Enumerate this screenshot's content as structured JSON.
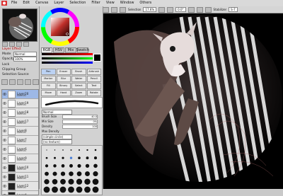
{
  "menubar": {
    "items": [
      "File",
      "Edit",
      "Canvas",
      "Layer",
      "Selection",
      "Filter",
      "View",
      "Window",
      "Others"
    ],
    "icon": "paint-icon"
  },
  "toolbar": {
    "selection_label": "Selection",
    "zoom": "17.6%",
    "angle": "0.0°",
    "stabilizer_label": "Stabilizer",
    "stabilizer_value": "S-7"
  },
  "left": {
    "layer_effect": "Layer Effect",
    "mode_label": "Mode",
    "mode_value": "Normal",
    "opacity_label": "Opacity",
    "opacity_value": "100%",
    "lock_label": "Lock",
    "clipping_group": "Clipping Group",
    "selection_source": "Selection Source",
    "layers": [
      {
        "name": "Layer20",
        "mode": "Normal",
        "selected": true,
        "dark": false
      },
      {
        "name": "Layer19",
        "mode": "Normal",
        "selected": false,
        "dark": false
      },
      {
        "name": "Layer18",
        "mode": "Normal",
        "selected": false,
        "dark": false
      },
      {
        "name": "Layer17",
        "mode": "Normal",
        "selected": false,
        "dark": false
      },
      {
        "name": "Layer8",
        "mode": "Normal",
        "selected": false,
        "dark": false
      },
      {
        "name": "Layer7",
        "mode": "Normal",
        "selected": false,
        "dark": false
      },
      {
        "name": "Layer6",
        "mode": "Normal",
        "selected": false,
        "dark": false
      },
      {
        "name": "Layer9",
        "mode": "Normal",
        "selected": false,
        "dark": false
      },
      {
        "name": "Layer10",
        "mode": "Normal",
        "selected": false,
        "dark": true
      },
      {
        "name": "Layer11",
        "mode": "Normal",
        "selected": false,
        "dark": true
      },
      {
        "name": "Layer12",
        "mode": "Normal",
        "selected": false,
        "dark": true
      },
      {
        "name": "Layer4",
        "mode": "Normal",
        "selected": false,
        "dark": true
      }
    ]
  },
  "tools": {
    "tabs": [
      "RGB",
      "HSV",
      "Mix",
      "Swatch"
    ],
    "items": [
      "Pen",
      "Eraser",
      "Brush",
      "Airbrush",
      "Marker",
      "Blur",
      "Water",
      "Pencil",
      "Fill",
      "Binary",
      "Select",
      "Text",
      "Move",
      "Hand",
      "Zoom",
      "Rotate"
    ]
  },
  "brush": {
    "mode": "Normal",
    "size_label": "Brush Size",
    "size_value": "40.0",
    "min_size_label": "Min Size",
    "min_size_value": "0%",
    "density_label": "Density",
    "density_value": "100",
    "blend_label": "Max Density",
    "shape_label": "(simple circle)",
    "texture_label": "(no texture)"
  },
  "colors": {
    "accent": "#4a7fd6",
    "layer_selected": "#9db8e6",
    "canvas_bg": "#000000"
  }
}
